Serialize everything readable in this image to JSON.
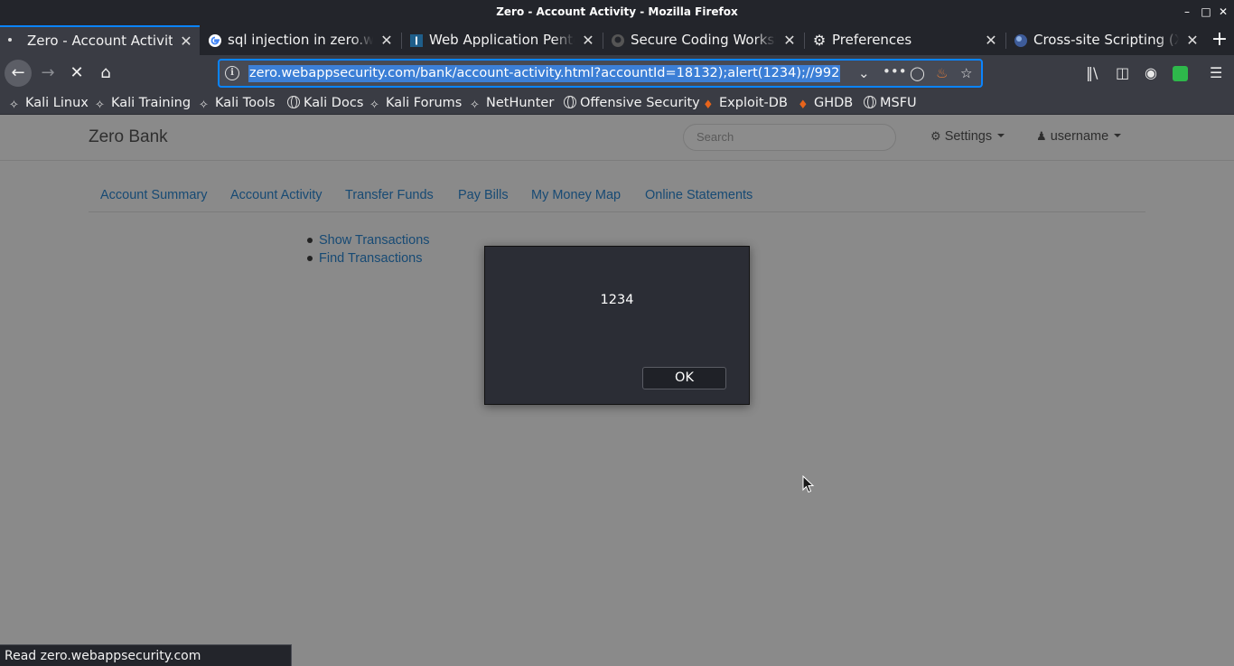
{
  "window": {
    "title": "Zero - Account Activity - Mozilla Firefox"
  },
  "tabs": [
    {
      "label": "Zero - Account Activity",
      "active": true,
      "icon": "dot-icon"
    },
    {
      "label": "sql injection in zero.webappsecurity.com",
      "active": false,
      "icon": "google-icon"
    },
    {
      "label": "Web Application Pentesting",
      "active": false,
      "icon": "instapaper-icon"
    },
    {
      "label": "Secure Coding Workshop",
      "active": false,
      "icon": "github-icon"
    },
    {
      "label": "Preferences",
      "active": false,
      "icon": "gear-icon"
    },
    {
      "label": "Cross-site Scripting (XSS)",
      "active": false,
      "icon": "globe-icon"
    }
  ],
  "navbar": {
    "url": "zero.webappsecurity.com/bank/account-activity.html?accountId=18132);alert(1234);//992"
  },
  "bookmarks": [
    {
      "label": "Kali Linux",
      "icon": "kali-dragon-icon"
    },
    {
      "label": "Kali Training",
      "icon": "kali-dragon-icon"
    },
    {
      "label": "Kali Tools",
      "icon": "kali-dragon-icon"
    },
    {
      "label": "Kali Docs",
      "icon": "globe-icon"
    },
    {
      "label": "Kali Forums",
      "icon": "kali-dragon-icon"
    },
    {
      "label": "NetHunter",
      "icon": "kali-dragon-icon"
    },
    {
      "label": "Offensive Security",
      "icon": "globe-icon"
    },
    {
      "label": "Exploit-DB",
      "icon": "exploitdb-icon"
    },
    {
      "label": "GHDB",
      "icon": "exploitdb-icon"
    },
    {
      "label": "MSFU",
      "icon": "globe-icon"
    }
  ],
  "site": {
    "brand": "Zero Bank",
    "search_placeholder": "Search",
    "settings_label": "Settings",
    "user_label": "username",
    "nav_tabs": [
      "Account Summary",
      "Account Activity",
      "Transfer Funds",
      "Pay Bills",
      "My Money Map",
      "Online Statements"
    ],
    "sub_links": [
      "Show Transactions",
      "Find Transactions"
    ]
  },
  "dialog": {
    "message": "1234",
    "ok_label": "OK"
  },
  "status_bar": {
    "text": "Read zero.webappsecurity.com"
  }
}
